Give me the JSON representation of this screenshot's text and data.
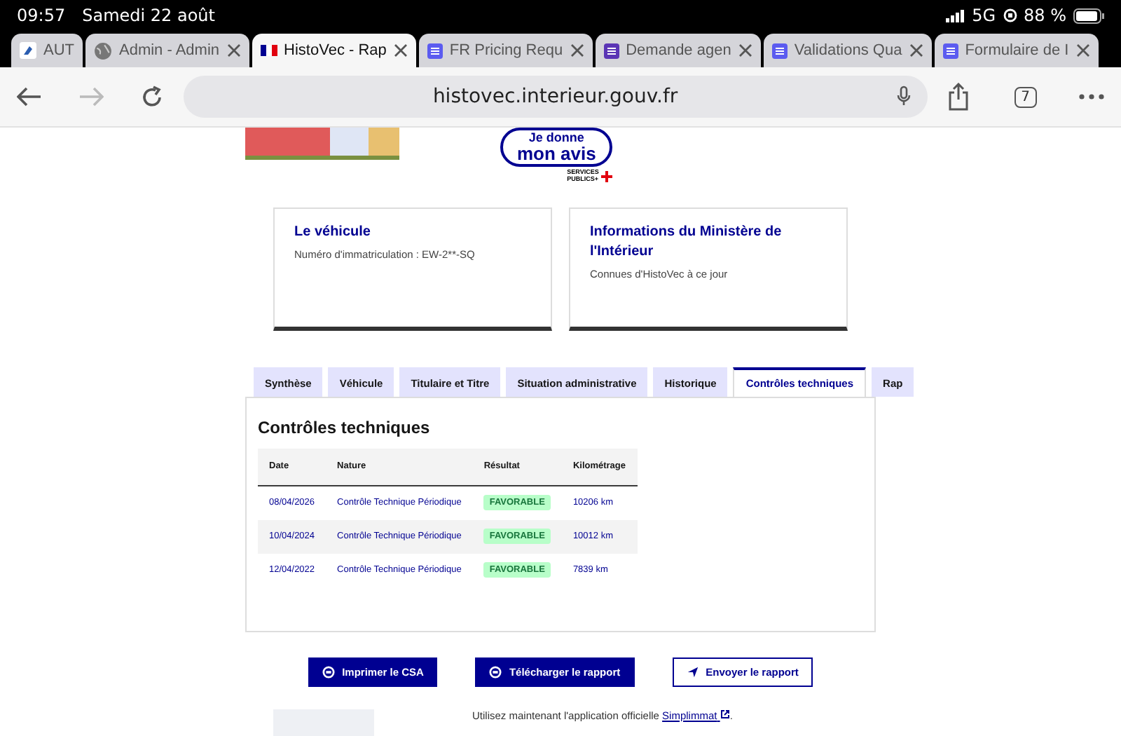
{
  "status_bar": {
    "time": "09:57",
    "date": "Samedi 22 août",
    "network": "5G",
    "battery": "88 %"
  },
  "browser_tabs": [
    {
      "title": "AUT",
      "kind": "app",
      "selected": false
    },
    {
      "title": "Admin - Admin",
      "kind": "web",
      "selected": false
    },
    {
      "title": "HistoVec - Rap",
      "kind": "gov",
      "selected": true
    },
    {
      "title": "FR Pricing Requ",
      "kind": "form",
      "selected": false
    },
    {
      "title": "Demande agen",
      "kind": "survey",
      "selected": false
    },
    {
      "title": "Validations Qua",
      "kind": "form",
      "selected": false
    },
    {
      "title": "Formulaire de I",
      "kind": "form",
      "selected": false
    }
  ],
  "address_bar": {
    "url": "histovec.interieur.gouv.fr",
    "tab_count": "7"
  },
  "feedback_badge": {
    "line_1": "Je donne",
    "line_2": "mon avis",
    "caption_1": "SERVICES",
    "caption_2": "PUBLICS+"
  },
  "cards": [
    {
      "title": "Le véhicule",
      "text": "Numéro d'immatriculation : EW-2**-SQ"
    },
    {
      "title": "Informations du Ministère de l'Intérieur",
      "text": "Connues d'HistoVec à ce jour"
    }
  ],
  "page_tabs": [
    {
      "label": "Synthèse",
      "selected": false
    },
    {
      "label": "Véhicule",
      "selected": false
    },
    {
      "label": "Titulaire et Titre",
      "selected": false
    },
    {
      "label": "Situation administrative",
      "selected": false
    },
    {
      "label": "Historique",
      "selected": false
    },
    {
      "label": "Contrôles techniques",
      "selected": true
    },
    {
      "label": "Rap",
      "selected": false
    }
  ],
  "section": {
    "title": "Contrôles techniques",
    "table": {
      "columns": [
        "Date",
        "Nature",
        "Résultat",
        "Kilométrage"
      ],
      "rows": [
        {
          "date": "08/04/2026",
          "nature": "Contrôle Technique Périodique",
          "result": "FAVORABLE",
          "mileage": "10206 km"
        },
        {
          "date": "10/04/2024",
          "nature": "Contrôle Technique Périodique",
          "result": "FAVORABLE",
          "mileage": "10012 km"
        },
        {
          "date": "12/04/2022",
          "nature": "Contrôle Technique Périodique",
          "result": "FAVORABLE",
          "mileage": "7839 km"
        }
      ]
    }
  },
  "actions": [
    {
      "label": "Imprimer le CSA",
      "kind": "primary"
    },
    {
      "label": "Télécharger le rapport",
      "kind": "primary"
    },
    {
      "label": "Envoyer le rapport",
      "kind": "secondary"
    }
  ],
  "promo": {
    "text": "Utilisez maintenant l'application officielle",
    "link": "Simplimmat",
    "after": "."
  }
}
